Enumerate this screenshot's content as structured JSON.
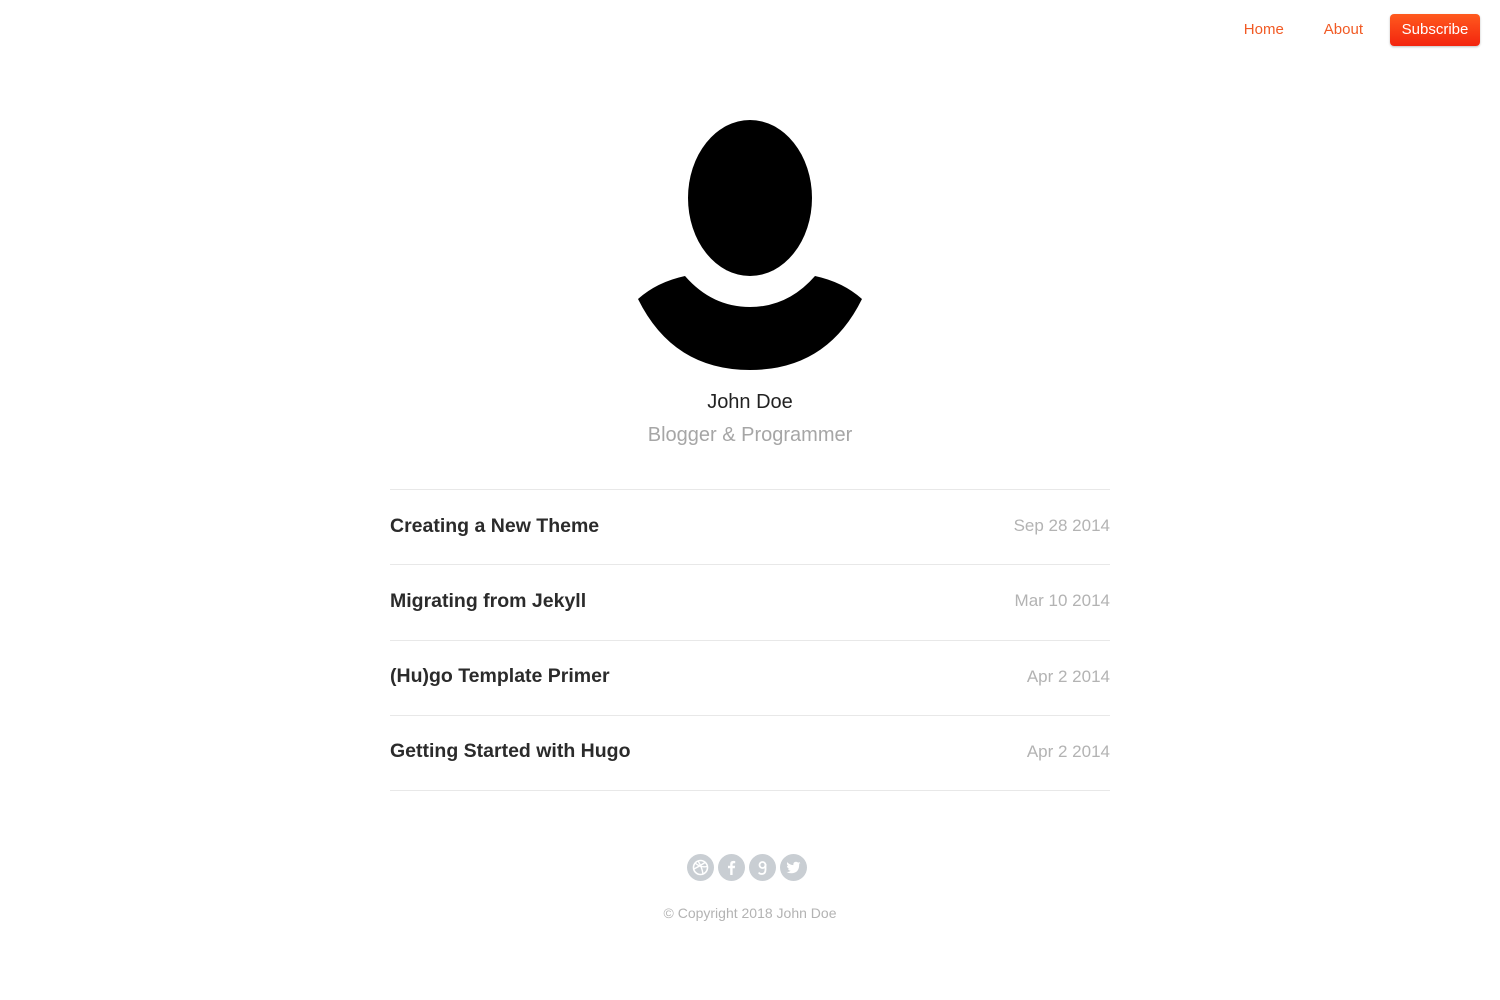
{
  "nav": {
    "items": [
      {
        "label": "Home"
      },
      {
        "label": "About"
      }
    ],
    "subscribe_label": "Subscribe"
  },
  "profile": {
    "name": "John Doe",
    "tagline": "Blogger & Programmer",
    "avatar_icon": "person-silhouette-icon"
  },
  "posts": [
    {
      "title": "Creating a New Theme",
      "date": "Sep 28 2014"
    },
    {
      "title": "Migrating from Jekyll",
      "date": "Mar 10 2014"
    },
    {
      "title": "(Hu)go Template Primer",
      "date": "Apr 2 2014"
    },
    {
      "title": "Getting Started with Hugo",
      "date": "Apr 2 2014"
    }
  ],
  "social": [
    {
      "icon": "dribbble-icon"
    },
    {
      "icon": "facebook-icon"
    },
    {
      "icon": "google-plus-icon"
    },
    {
      "icon": "twitter-icon"
    }
  ],
  "footer": {
    "copyright": "© Copyright 2018 John Doe"
  },
  "colors": {
    "accent": "#f15a24",
    "subscribe_gradient_top": "#ff5a1e",
    "subscribe_gradient_bottom": "#f3240e",
    "muted_text": "#a6a6a6",
    "social_circle": "#c9ced3"
  }
}
